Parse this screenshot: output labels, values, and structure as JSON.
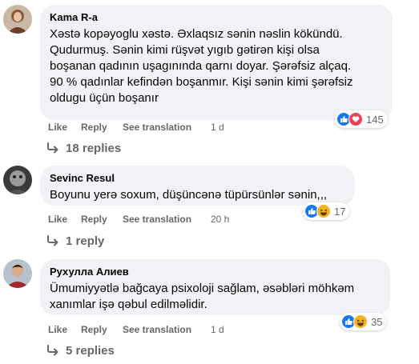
{
  "comments": [
    {
      "author": "Kama R-a",
      "text_lines": [
        "Xəstə kopəyoglu xəstə. Əxlaqsız sənin nəslin kökündü.",
        "Qudurmuş. Sənin kimi rüşvət yıgıb gətirən kişi olsa",
        "boşanan qadının uşagınında qarnı doyar. Şərəfsiz alçaq.",
        "90 % qadınlar kefindən boşanmır. Kişi sənin kimi şərəfsiz",
        "oldugu üçün boşanır"
      ],
      "like": "Like",
      "reply": "Reply",
      "translate": "See translation",
      "time": "1 d",
      "reactions": [
        "like-icon",
        "love-icon"
      ],
      "reaction_count": "145",
      "replies_label": "18 replies"
    },
    {
      "author": "Sevinc Resul",
      "text_lines": [
        "Boyunu yerə soxum, düşüncənə tüpürsünlər sənin,,,"
      ],
      "like": "Like",
      "reply": "Reply",
      "translate": "See translation",
      "time": "20 h",
      "reactions": [
        "like-icon",
        "haha-icon"
      ],
      "reaction_count": "17",
      "replies_label": "1 reply"
    },
    {
      "author": "Рухулла Алиев",
      "text_lines": [
        "Ümumiyyətlə bağcaya psixoloji sağlam, əsəbləri möhkəm",
        "xanımlar işə qəbul edilməlidir."
      ],
      "like": "Like",
      "reply": "Reply",
      "translate": "See translation",
      "time": "1 d",
      "reactions": [
        "like-icon",
        "haha-icon"
      ],
      "reaction_count": "35",
      "replies_label": "5 replies"
    }
  ],
  "colors": {
    "like": "#1877f2",
    "love": "#f33e58",
    "haha": "#f7b125",
    "bubble": "#f0f2f5",
    "meta": "#65676b"
  }
}
